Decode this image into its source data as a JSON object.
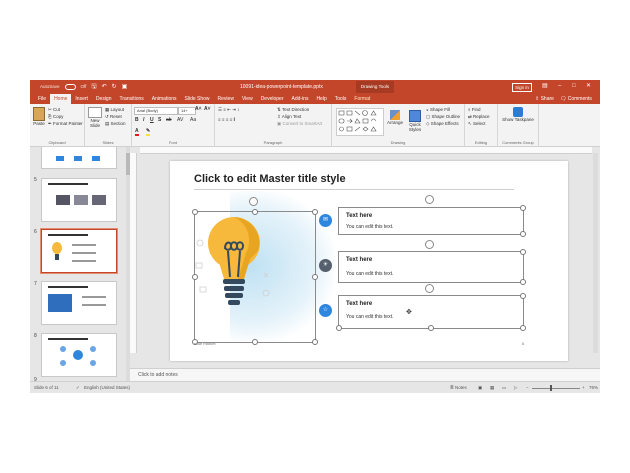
{
  "titlebar": {
    "autosave_label": "AutoSave",
    "autosave_state": "Off",
    "document_title": "10091-idea-powerpoint-template.pptx",
    "context_tab_group": "Drawing Tools",
    "sign_in": "Sign in",
    "icons": [
      "save-icon",
      "undo-icon",
      "redo-icon",
      "present-icon"
    ]
  },
  "tabs": [
    "File",
    "Home",
    "Insert",
    "Design",
    "Transitions",
    "Animations",
    "Slide Show",
    "Review",
    "View",
    "Developer",
    "Add-ins",
    "Help",
    "Tools",
    "Format"
  ],
  "active_tab": "Home",
  "share_label": "Share",
  "comments_label": "Comments",
  "ribbon": {
    "clipboard": {
      "paste": "Paste",
      "cut": "Cut",
      "copy": "Copy",
      "format_painter": "Format Painter",
      "label": "Clipboard"
    },
    "slides": {
      "new_slide": "New Slide",
      "layout": "Layout",
      "reset": "Reset",
      "section": "Section",
      "label": "Slides"
    },
    "font": {
      "font_name": "Arial (Body)",
      "font_size": "14+",
      "label": "Font"
    },
    "paragraph": {
      "text_direction": "Text Direction",
      "align_text": "Align Text",
      "convert_smartart": "Convert to SmartArt",
      "label": "Paragraph"
    },
    "drawing": {
      "arrange": "Arrange",
      "quick_styles": "Quick Styles",
      "shape_fill": "Shape Fill",
      "shape_outline": "Shape Outline",
      "shape_effects": "Shape Effects",
      "label": "Drawing"
    },
    "editing": {
      "find": "Find",
      "replace": "Replace",
      "select": "Select",
      "label": "Editing"
    },
    "comments": {
      "show_taskpane": "Show Taskpane",
      "label": "Comments Group"
    }
  },
  "thumbnails": {
    "slide_numbers": [
      "5",
      "6",
      "7",
      "8",
      "9"
    ],
    "selected": "6"
  },
  "slide": {
    "title": "Click to edit Master title style",
    "items": [
      {
        "title": "Text here",
        "body": "You can edit this text."
      },
      {
        "title": "Text here",
        "body": "You can edit this text."
      },
      {
        "title": "Text here",
        "body": "You can edit this text."
      }
    ],
    "footer": "slide market",
    "page_number": "6",
    "colors": {
      "bulb_yellow": "#f6b93b",
      "bulb_dark": "#34495e",
      "circle_blue": "#2e86de",
      "circle_gray": "#555f6d"
    }
  },
  "notes_placeholder": "Click to add notes",
  "statusbar": {
    "slide_info": "Slide 6 of 11",
    "language": "English (United States)",
    "notes_label": "Notes",
    "zoom": "76%"
  },
  "colors": {
    "accent": "#c4462a"
  }
}
